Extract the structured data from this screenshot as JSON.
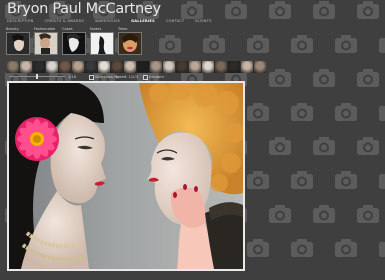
{
  "header": {
    "title": "Bryon Paul McCartney"
  },
  "nav": [
    {
      "label": "Description",
      "active": false
    },
    {
      "label": "Credits & Awards",
      "active": false
    },
    {
      "label": "Warehouse",
      "active": false
    },
    {
      "label": "Galleries",
      "active": true
    },
    {
      "label": "Contact",
      "active": false
    },
    {
      "label": "Klients",
      "active": false
    }
  ],
  "categories": [
    {
      "label": "Beauty",
      "thumb": "beauty"
    },
    {
      "label": "Fashionable",
      "thumb": "fashion"
    },
    {
      "label": "Cases",
      "thumb": "cases"
    },
    {
      "label": "Nudes",
      "thumb": "nudes"
    },
    {
      "label": "Trees",
      "thumb": "trees"
    }
  ],
  "controls": {
    "slider_value": 0.5,
    "page_counter": "1/16",
    "slideshow_label": "Slideshow On",
    "speed_label": "Speed: 1/2/3",
    "random_label": "Random"
  },
  "colors": {
    "background": "#3f3f3f",
    "pattern_icon": "#5c5c5c",
    "frame": "#e9e9e9",
    "flower": "#e8216a",
    "hair": "#e7a23c"
  },
  "icons": {
    "background_pattern": "camera-icon"
  }
}
